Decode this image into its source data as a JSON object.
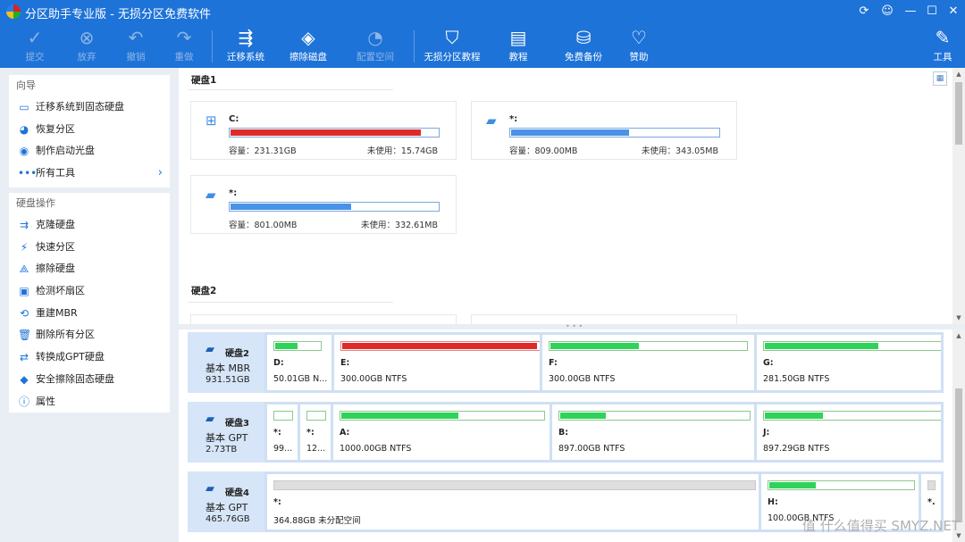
{
  "window": {
    "title": "分区助手专业版 - 无损分区免费软件",
    "controls": [
      "⟳",
      "☺",
      "—",
      "☐",
      "✕"
    ]
  },
  "toolbar": {
    "buttons": [
      {
        "label": "提交",
        "icon": "✓"
      },
      {
        "label": "放弃",
        "icon": "⊗"
      },
      {
        "label": "撤销",
        "icon": "↶"
      },
      {
        "label": "重做",
        "icon": "↷"
      },
      {
        "label": "迁移系统",
        "icon": "⇶"
      },
      {
        "label": "擦除磁盘",
        "icon": "◈"
      },
      {
        "label": "配置空间",
        "icon": "◔"
      },
      {
        "label": "无损分区教程",
        "icon": "⛉"
      },
      {
        "label": "教程",
        "icon": "▤"
      },
      {
        "label": "免费备份",
        "icon": "⛁"
      },
      {
        "label": "赞助",
        "icon": "♡"
      },
      {
        "label": "工具",
        "icon": "✎"
      }
    ]
  },
  "sidebar": {
    "wizard": {
      "title": "向导",
      "items": [
        {
          "label": "迁移系统到固态硬盘",
          "icon": "▭"
        },
        {
          "label": "恢复分区",
          "icon": "◕"
        },
        {
          "label": "制作启动光盘",
          "icon": "◉"
        },
        {
          "label": "所有工具",
          "icon": "•••",
          "chevron": "›"
        }
      ]
    },
    "disk_ops": {
      "title": "硬盘操作",
      "items": [
        {
          "label": "克隆硬盘",
          "icon": "⇉"
        },
        {
          "label": "快速分区",
          "icon": "⚡"
        },
        {
          "label": "擦除硬盘",
          "icon": "⟁"
        },
        {
          "label": "检测坏扇区",
          "icon": "▣"
        },
        {
          "label": "重建MBR",
          "icon": "⟲"
        },
        {
          "label": "删除所有分区",
          "icon": "🗑"
        },
        {
          "label": "转换成GPT硬盘",
          "icon": "⇄"
        },
        {
          "label": "安全擦除固态硬盘",
          "icon": "◆"
        },
        {
          "label": "属性",
          "icon": "ⓘ"
        }
      ]
    }
  },
  "main": {
    "disk1": {
      "title": "硬盘1",
      "partitions": [
        {
          "name": "C:",
          "capacity": "容量：231.31GB",
          "free": "未使用：15.74GB",
          "used_fraction": 0.92,
          "color": "#e02a2a",
          "icon": "⊞"
        },
        {
          "name": "*:",
          "capacity": "容量：809.00MB",
          "free": "未使用：343.05MB",
          "used_fraction": 0.57,
          "color": "#4a92e8",
          "icon": "▰"
        },
        {
          "name": "*:",
          "capacity": "容量：801.00MB",
          "free": "未使用：332.61MB",
          "used_fraction": 0.58,
          "color": "#4a92e8",
          "icon": "▰"
        }
      ]
    },
    "disk2_title": "硬盘2"
  },
  "bottom": {
    "disks": [
      {
        "name": "硬盘2",
        "type": "基本 MBR",
        "size": "931.51GB",
        "parts": [
          {
            "label": "D:",
            "size": "50.01GB N...",
            "used_fraction": 0.5,
            "color": "#2fd35a"
          },
          {
            "label": "E:",
            "size": "300.00GB NTFS",
            "used_fraction": 0.99,
            "color": "#e02a2a"
          },
          {
            "label": "F:",
            "size": "300.00GB NTFS",
            "used_fraction": 0.45,
            "color": "#2fd35a"
          },
          {
            "label": "G:",
            "size": "281.50GB NTFS",
            "used_fraction": 0.65,
            "color": "#2fd35a"
          }
        ]
      },
      {
        "name": "硬盘3",
        "type": "基本 GPT",
        "size": "2.73TB",
        "parts": [
          {
            "label": "*:",
            "size": "99...",
            "used_fraction": 0.0,
            "color": "#2fd35a"
          },
          {
            "label": "*:",
            "size": "12...",
            "used_fraction": 0.0,
            "color": "#2fd35a"
          },
          {
            "label": "A:",
            "size": "1000.00GB NTFS",
            "used_fraction": 0.58,
            "color": "#2fd35a"
          },
          {
            "label": "B:",
            "size": "897.00GB NTFS",
            "used_fraction": 0.24,
            "color": "#2fd35a"
          },
          {
            "label": "J:",
            "size": "897.29GB NTFS",
            "used_fraction": 0.33,
            "color": "#2fd35a"
          }
        ]
      },
      {
        "name": "硬盘4",
        "type": "基本 GPT",
        "size": "465.76GB",
        "parts": [
          {
            "label": "*:",
            "size": "364.88GB 未分配空间",
            "used_fraction": 0.0,
            "color": "#dedede",
            "unallocated": true
          },
          {
            "label": "H:",
            "size": "100.00GB NTFS",
            "used_fraction": 0.32,
            "color": "#2fd35a"
          },
          {
            "label": "*.",
            "size": "",
            "used_fraction": 0.0,
            "color": "#dedede",
            "unallocated": true
          }
        ]
      }
    ]
  },
  "watermark": "值 什么值得买 SMYZ.NET"
}
